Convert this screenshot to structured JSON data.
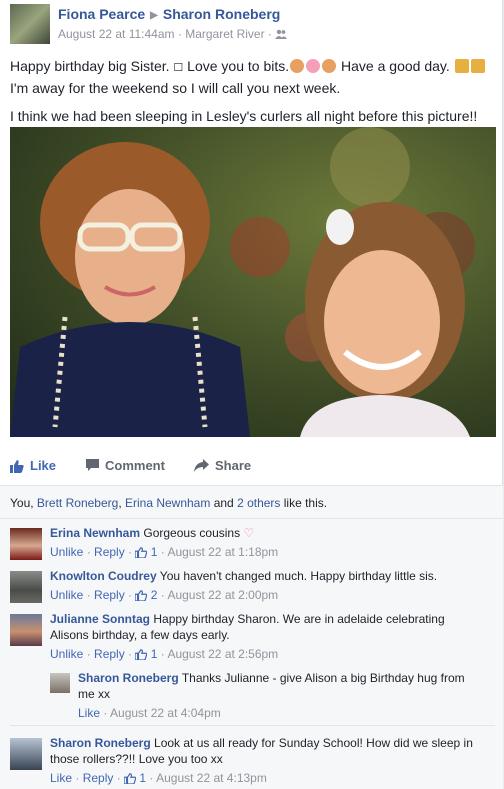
{
  "post": {
    "author": "Fiona Pearce",
    "target": "Sharon Roneberg",
    "date": "August 22 at 11:44am",
    "location": "Margaret River",
    "line1_a": "Happy birthday big Sister. ",
    "line1_b": " Love you to bits.",
    "line1_c": " Have a good day. ",
    "line2": "I'm away for the weekend so I will call you next week.",
    "line3": "I think we had been sleeping in Lesley's curlers all night before this picture!!"
  },
  "actions": {
    "like": "Like",
    "comment": "Comment",
    "share": "Share"
  },
  "likes": {
    "you": "You, ",
    "p1": "Brett Roneberg",
    "sep": ", ",
    "p2": "Erina Newnham",
    "and": " and ",
    "others": "2 others",
    "suffix": " like this."
  },
  "colors": {
    "link": "#365899",
    "accent": "#4267b2",
    "muted": "#90949c"
  },
  "comments": [
    {
      "author": "Erina Newnham",
      "text": "Gorgeous cousins",
      "action": "Unlike",
      "reply": "Reply",
      "likes": "1",
      "time": "August 22 at 1:18pm"
    },
    {
      "author": "Knowlton Coudrey",
      "text": "You haven't changed much. Happy birthday little sis.",
      "action": "Unlike",
      "reply": "Reply",
      "likes": "2",
      "time": "August 22 at 2:00pm"
    },
    {
      "author": "Julianne Sonntag",
      "text": "Happy birthday Sharon. We are in adelaide celebrating",
      "text2": "Alisons birthday, a few days early.",
      "action": "Unlike",
      "reply": "Reply",
      "likes": "1",
      "time": "August 22 at 2:56pm"
    },
    {
      "author": "Sharon Roneberg",
      "text": "Thanks Julianne - give Alison a big Birthday hug from",
      "text2": "me xx",
      "action": "Like",
      "time": "August 22 at 4:04pm"
    },
    {
      "author": "Sharon Roneberg",
      "text": "Look at us all ready for Sunday School! How did we sleep in",
      "text2": "those rollers??!! Love you too xx",
      "action": "Like",
      "reply": "Reply",
      "likes": "1",
      "time": "August 22 at 4:13pm"
    }
  ]
}
